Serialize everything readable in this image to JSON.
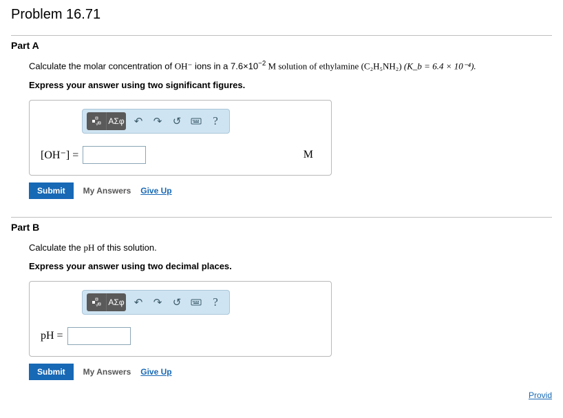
{
  "problem_title": "Problem 16.71",
  "partA": {
    "heading": "Part A",
    "question_pre": "Calculate the molar concentration of ",
    "question_species": "OH⁻",
    "question_mid": " ions in a 7.6×10",
    "question_exp": "−2",
    "question_post1": " M solution of ethylamine ",
    "question_formula": "(C₂H₅NH₂)",
    "question_kb": " (K_b = 6.4 × 10⁻⁴).",
    "instruction": "Express your answer using two significant figures.",
    "toolbar": {
      "greek": "ΑΣφ"
    },
    "label": "[OH⁻] = ",
    "value": "",
    "unit": "M",
    "submit": "Submit",
    "my_answers": "My Answers",
    "give_up": "Give Up"
  },
  "partB": {
    "heading": "Part B",
    "question": "Calculate the pH of this solution.",
    "instruction": "Express your answer using two decimal places.",
    "toolbar": {
      "greek": "ΑΣφ"
    },
    "label": "pH = ",
    "value": "",
    "submit": "Submit",
    "my_answers": "My Answers",
    "give_up": "Give Up"
  },
  "footer_link": "Provid"
}
